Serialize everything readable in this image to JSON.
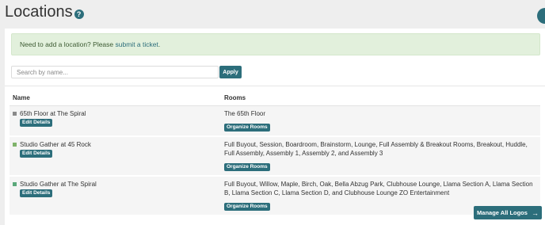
{
  "header": {
    "title": "Locations",
    "help_icon": "?"
  },
  "alert": {
    "text": "Need to add a location? Please ",
    "link": "submit a ticket",
    "suffix": "."
  },
  "search": {
    "placeholder": "Search by name...",
    "apply_label": "Apply"
  },
  "table": {
    "columns": [
      "Name",
      "Rooms"
    ],
    "rows": [
      {
        "name": "65th Floor at The Spiral",
        "swatch_color": "#8a8a8a",
        "details_label": "Edit Details",
        "rooms": "The 65th Floor",
        "organize_label": "Organize Rooms"
      },
      {
        "name": "Studio Gather at 45 Rock",
        "swatch_color": "#7fb36a",
        "details_label": "Edit Details",
        "rooms": "Full Buyout, Session, Boardroom, Brainstorm, Lounge, Full Assembly & Breakout Rooms, Breakout, Huddle, Full Assembly, Assembly 1, Assembly 2, and Assembly 3",
        "organize_label": "Organize Rooms"
      },
      {
        "name": "Studio Gather at The Spiral",
        "swatch_color": "#5aa87a",
        "details_label": "Edit Details",
        "rooms": "Full Buyout, Willow, Maple, Birch, Oak, Bella Abzug Park, Clubhouse Lounge, Llama Section A, Llama Section B, Llama Section C, Llama Section D, and Clubhouse Lounge ZO Entertainment",
        "organize_label": "Organize Rooms"
      }
    ]
  },
  "footer": {
    "manage_logos_label": "Manage All Logos",
    "arrow": "→"
  },
  "colors": {
    "accent": "#2c6e7b",
    "alert_bg": "#e2f0dc"
  }
}
